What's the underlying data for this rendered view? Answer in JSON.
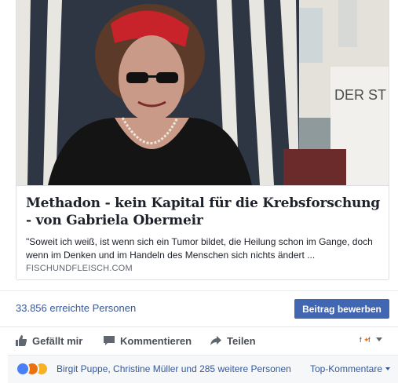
{
  "link_preview": {
    "title": "Methadon - kein Kapital für die Krebsforschung - von Gabriela Obermeir",
    "description": "\"Soweit ich weiß, ist wenn sich ein Tumor bildet, die Heilung schon im Gange, doch wenn im Denken und im Handeln des Menschen sich nichts ändert ...",
    "domain": "FISCHUNDFLEISCH.COM",
    "image_sign_text": "DER ST"
  },
  "stats": {
    "reach_text": "33.856 erreichte Personen",
    "boost_label": "Beitrag bewerben"
  },
  "actions": {
    "like_label": "Gefällt mir",
    "comment_label": "Kommentieren",
    "share_label": "Teilen"
  },
  "reactions": {
    "names_text": "Birgit Puppe, Christine Müller und 285 weitere Personen",
    "filter_label": "Top-Kommentare",
    "icons": [
      "like-reaction-icon",
      "angry-reaction-icon",
      "sad-reaction-icon"
    ]
  },
  "colors": {
    "primary_button": "#4267b2",
    "link": "#365899",
    "action_text": "#4b4f56"
  }
}
